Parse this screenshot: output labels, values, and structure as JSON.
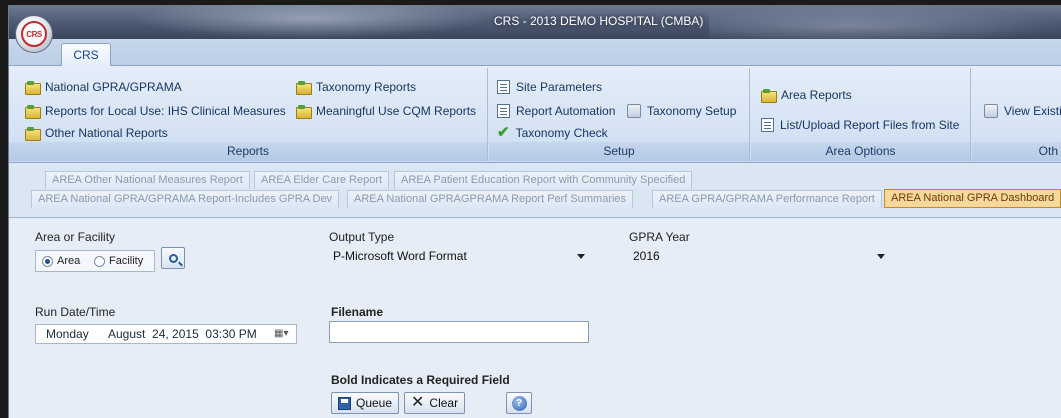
{
  "window": {
    "title": "CRS - 2013 DEMO HOSPITAL (CMBA)",
    "orb_text": "CRS"
  },
  "ribbon_tabs": [
    "CRS"
  ],
  "ribbon": {
    "reports": {
      "label": "Reports",
      "items": [
        "National GPRA/GPRAMA",
        "Reports for Local Use: IHS Clinical Measures",
        "Other National Reports",
        "Taxonomy Reports",
        "Meaningful Use CQM Reports"
      ]
    },
    "setup": {
      "label": "Setup",
      "items": [
        "Site Parameters",
        "Report Automation",
        "Taxonomy Setup",
        "Taxonomy Check"
      ]
    },
    "area_options": {
      "label": "Area Options",
      "items": [
        "Area Reports",
        "List/Upload Report Files from Site"
      ]
    },
    "other": {
      "label": "Oth",
      "items": [
        "View Existin"
      ]
    }
  },
  "doc_tabs": {
    "row1": [
      "AREA Other National Measures Report",
      "AREA Elder Care Report",
      "AREA Patient Education Report with Community Specified"
    ],
    "row2": [
      "AREA National GPRA/GPRAMA Report-Includes GPRA Dev",
      "AREA National GPRAGPRAMA Report Perf Summaries",
      "AREA GPRA/GPRAMA Performance Report",
      "AREA National GPRA Dashboard"
    ]
  },
  "form": {
    "area_label": "Area or Facility",
    "radio_area": "Area",
    "radio_facility": "Facility",
    "output_type_label": "Output Type",
    "output_type_value": "P-Microsoft Word Format",
    "gpra_year_label": "GPRA Year",
    "gpra_year_value": "2016",
    "run_date_label": "Run Date/Time",
    "run_date": {
      "day": "Monday",
      "date": "August  24, 2015  03:30 PM"
    },
    "filename_label": "Filename",
    "filename_value": "",
    "required_note": "Bold Indicates a Required Field",
    "queue_label": "Queue",
    "clear_label": "Clear"
  }
}
